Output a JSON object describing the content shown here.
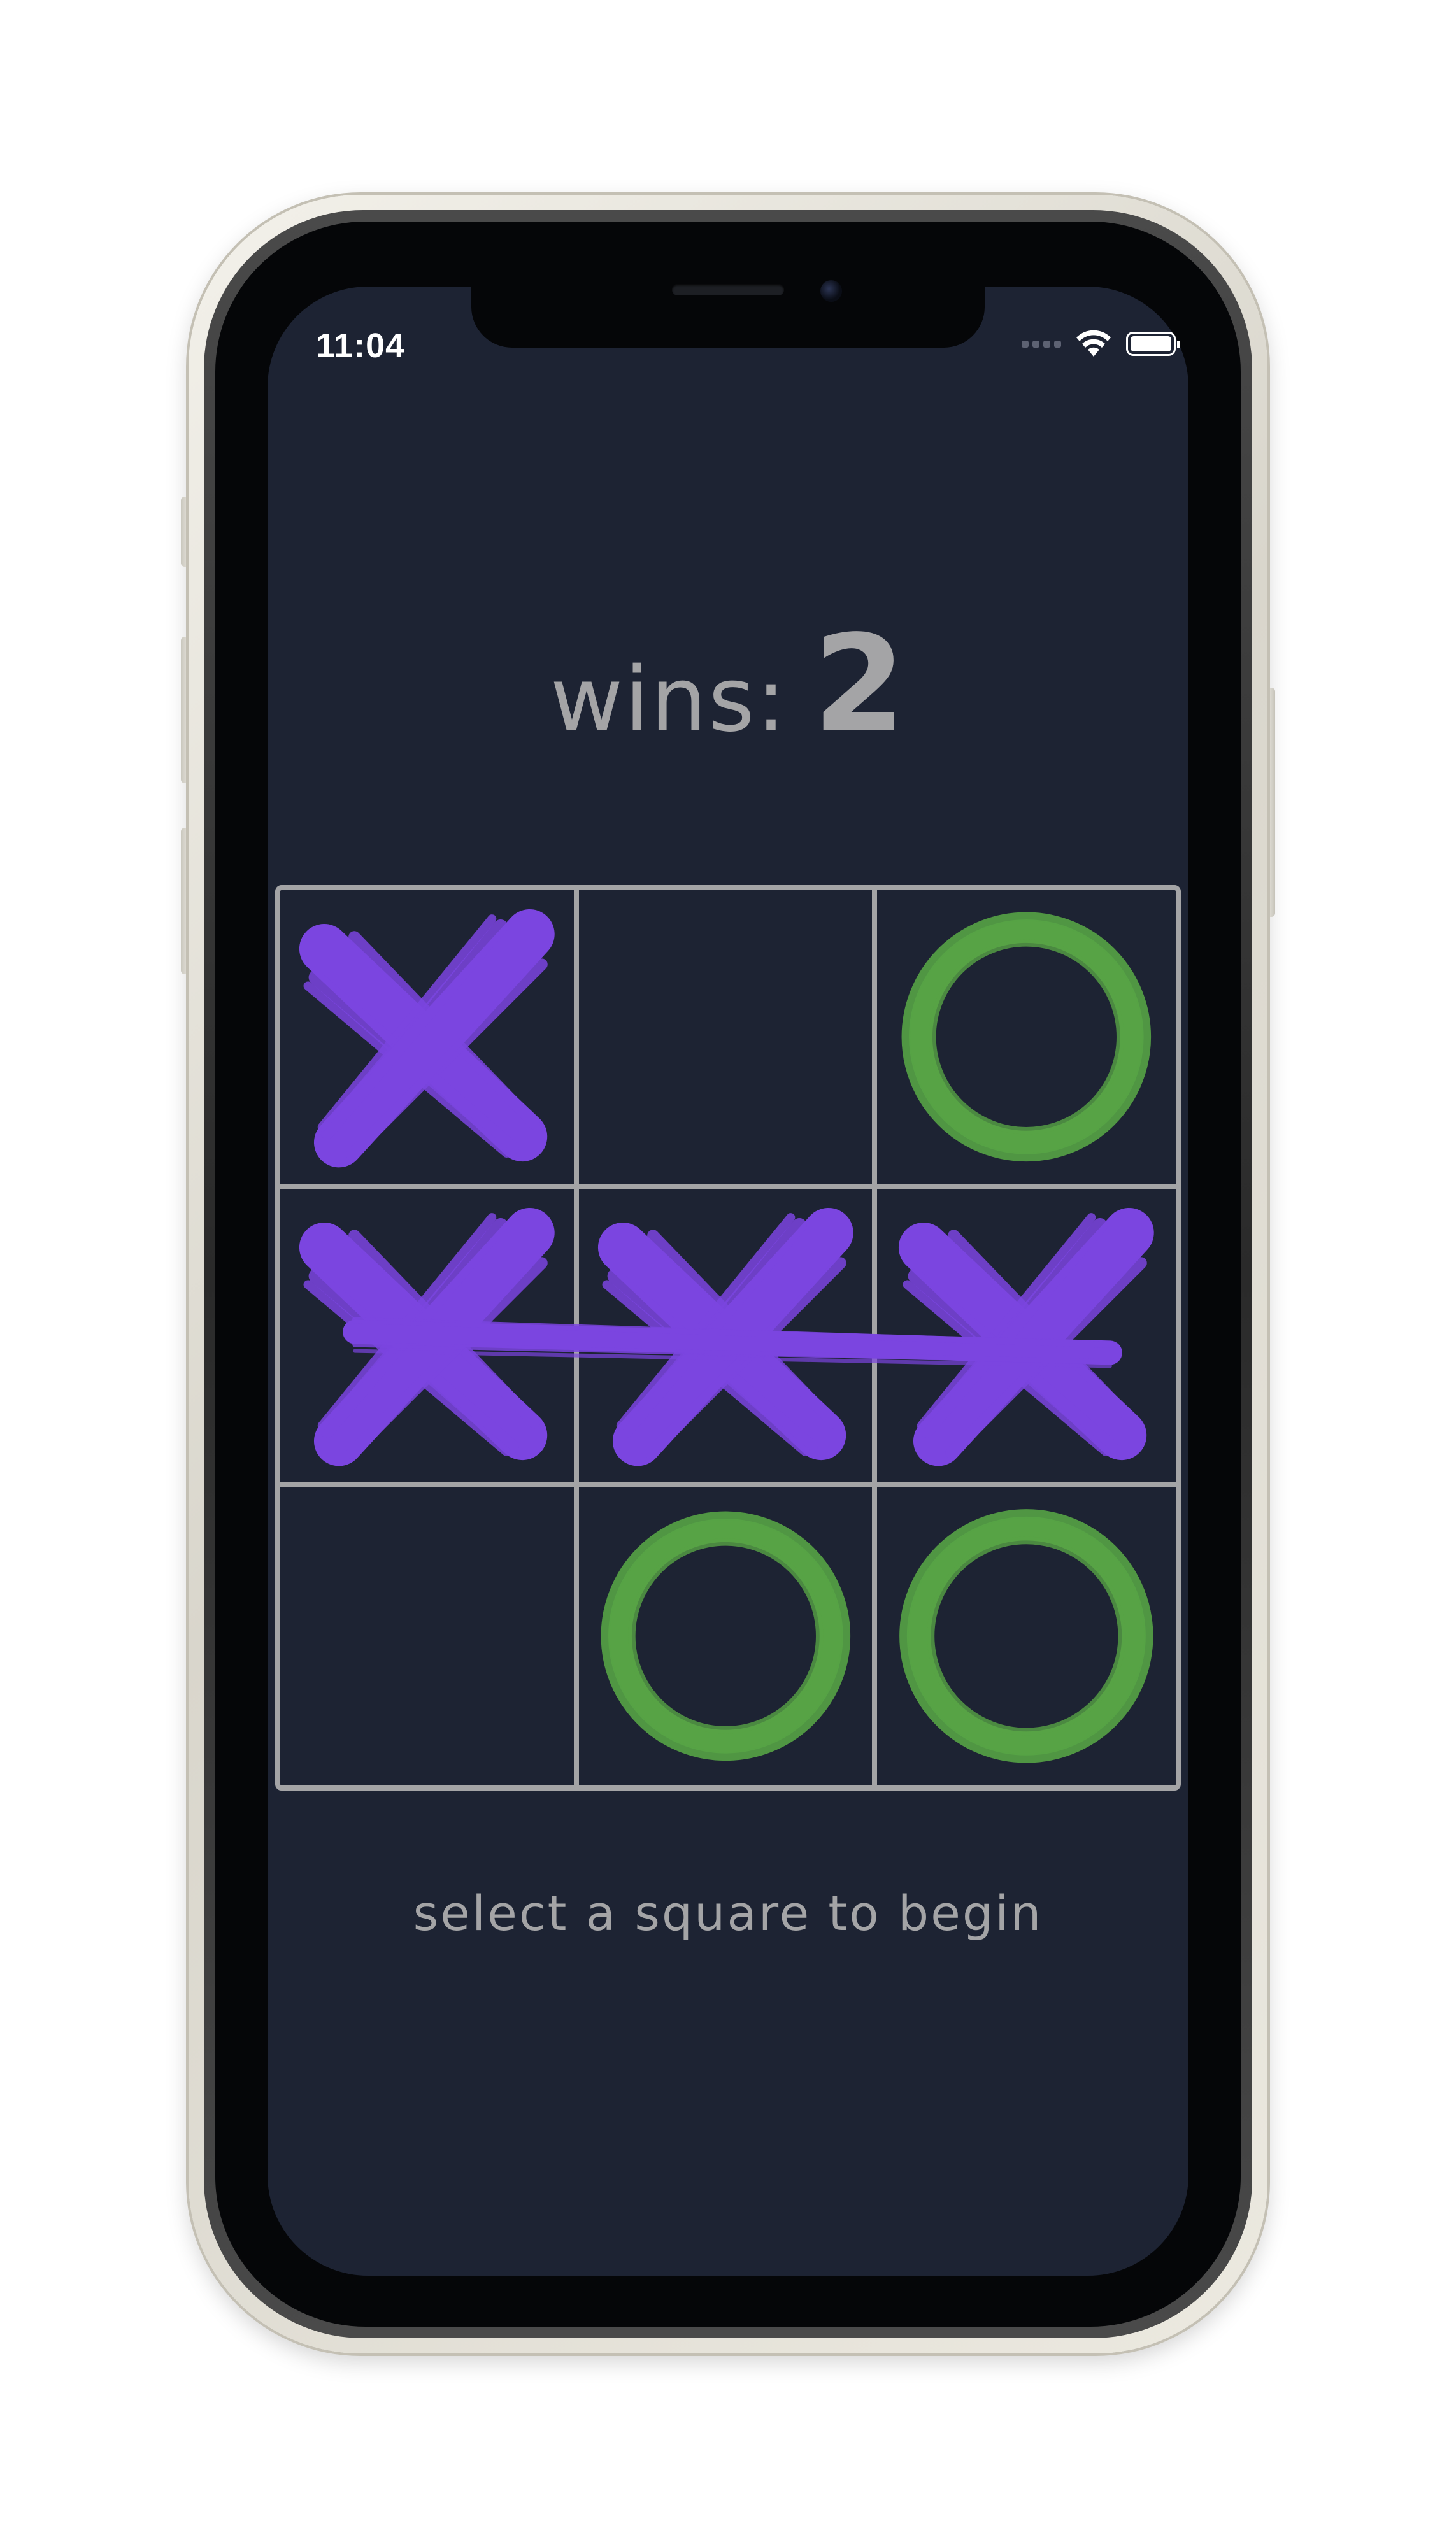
{
  "status_bar": {
    "time": "11:04"
  },
  "score": {
    "label": "wins:",
    "value": "2"
  },
  "board": {
    "cells": [
      "X",
      "",
      "O",
      "X",
      "X",
      "X",
      "",
      "O",
      "O"
    ],
    "winning_line": [
      3,
      4,
      5
    ]
  },
  "prompt": "select a square to begin",
  "colors": {
    "background": "#1d2333",
    "grid": "#a4a4a6",
    "text": "#a4a4a6",
    "x_mark": "#7b45e0",
    "o_mark": "#57a345"
  },
  "icons": {
    "signal": "cellular-signal-icon",
    "wifi": "wifi-icon",
    "battery": "battery-icon",
    "x": "brush-x-mark-icon",
    "o": "brush-o-mark-icon"
  }
}
